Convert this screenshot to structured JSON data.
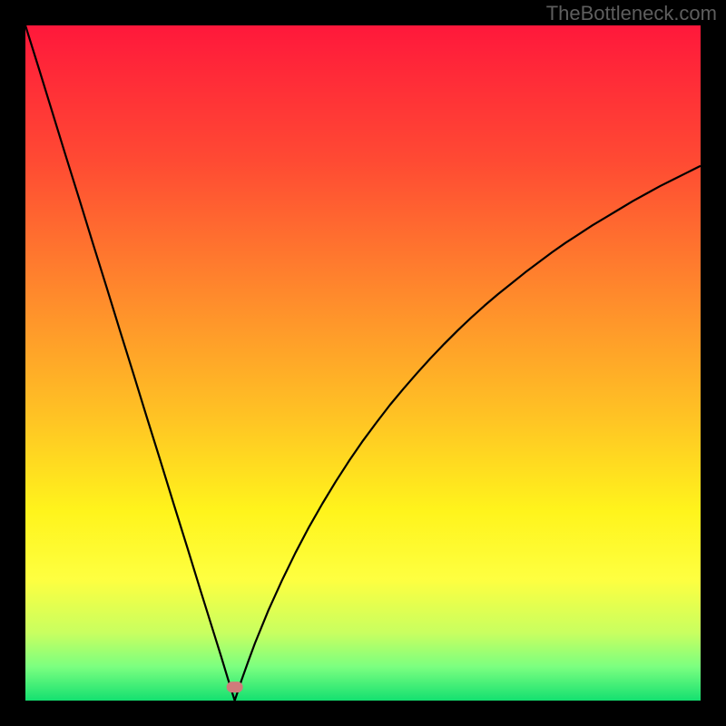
{
  "watermark": "TheBottleneck.com",
  "chart_data": {
    "type": "line",
    "title": "",
    "xlabel": "",
    "ylabel": "",
    "xlim": [
      0,
      100
    ],
    "ylim": [
      0,
      100
    ],
    "curve_minimum_x": 31,
    "marker": {
      "x": 31,
      "y": 2,
      "color": "#cf7b7b"
    },
    "x": [
      0,
      2,
      4,
      6,
      8,
      10,
      12,
      14,
      16,
      18,
      20,
      22,
      24,
      26,
      28,
      29,
      30,
      30.5,
      31,
      31.5,
      32,
      33,
      34,
      36,
      38,
      40,
      42,
      44,
      46,
      48,
      50,
      52,
      54,
      56,
      58,
      60,
      62,
      64,
      66,
      68,
      70,
      72,
      74,
      76,
      78,
      80,
      82,
      84,
      86,
      88,
      90,
      92,
      94,
      96,
      98,
      100
    ],
    "y": [
      100,
      93.6,
      87.1,
      80.6,
      74.2,
      67.7,
      61.3,
      54.8,
      48.4,
      41.9,
      35.5,
      29.0,
      22.6,
      16.1,
      9.7,
      6.5,
      3.2,
      1.6,
      0.0,
      1.5,
      3.0,
      5.8,
      8.5,
      13.4,
      17.8,
      21.9,
      25.7,
      29.2,
      32.5,
      35.6,
      38.5,
      41.2,
      43.8,
      46.2,
      48.5,
      50.7,
      52.8,
      54.8,
      56.7,
      58.5,
      60.2,
      61.8,
      63.4,
      64.9,
      66.4,
      67.8,
      69.1,
      70.4,
      71.6,
      72.8,
      74.0,
      75.1,
      76.2,
      77.2,
      78.2,
      79.2
    ],
    "background_gradient_stops": [
      {
        "offset": 0.0,
        "color": "#ff183b"
      },
      {
        "offset": 0.2,
        "color": "#ff4a33"
      },
      {
        "offset": 0.4,
        "color": "#ff8a2c"
      },
      {
        "offset": 0.58,
        "color": "#ffc324"
      },
      {
        "offset": 0.72,
        "color": "#fff41c"
      },
      {
        "offset": 0.82,
        "color": "#feff40"
      },
      {
        "offset": 0.9,
        "color": "#c8ff60"
      },
      {
        "offset": 0.95,
        "color": "#7bff80"
      },
      {
        "offset": 1.0,
        "color": "#14e070"
      }
    ]
  }
}
